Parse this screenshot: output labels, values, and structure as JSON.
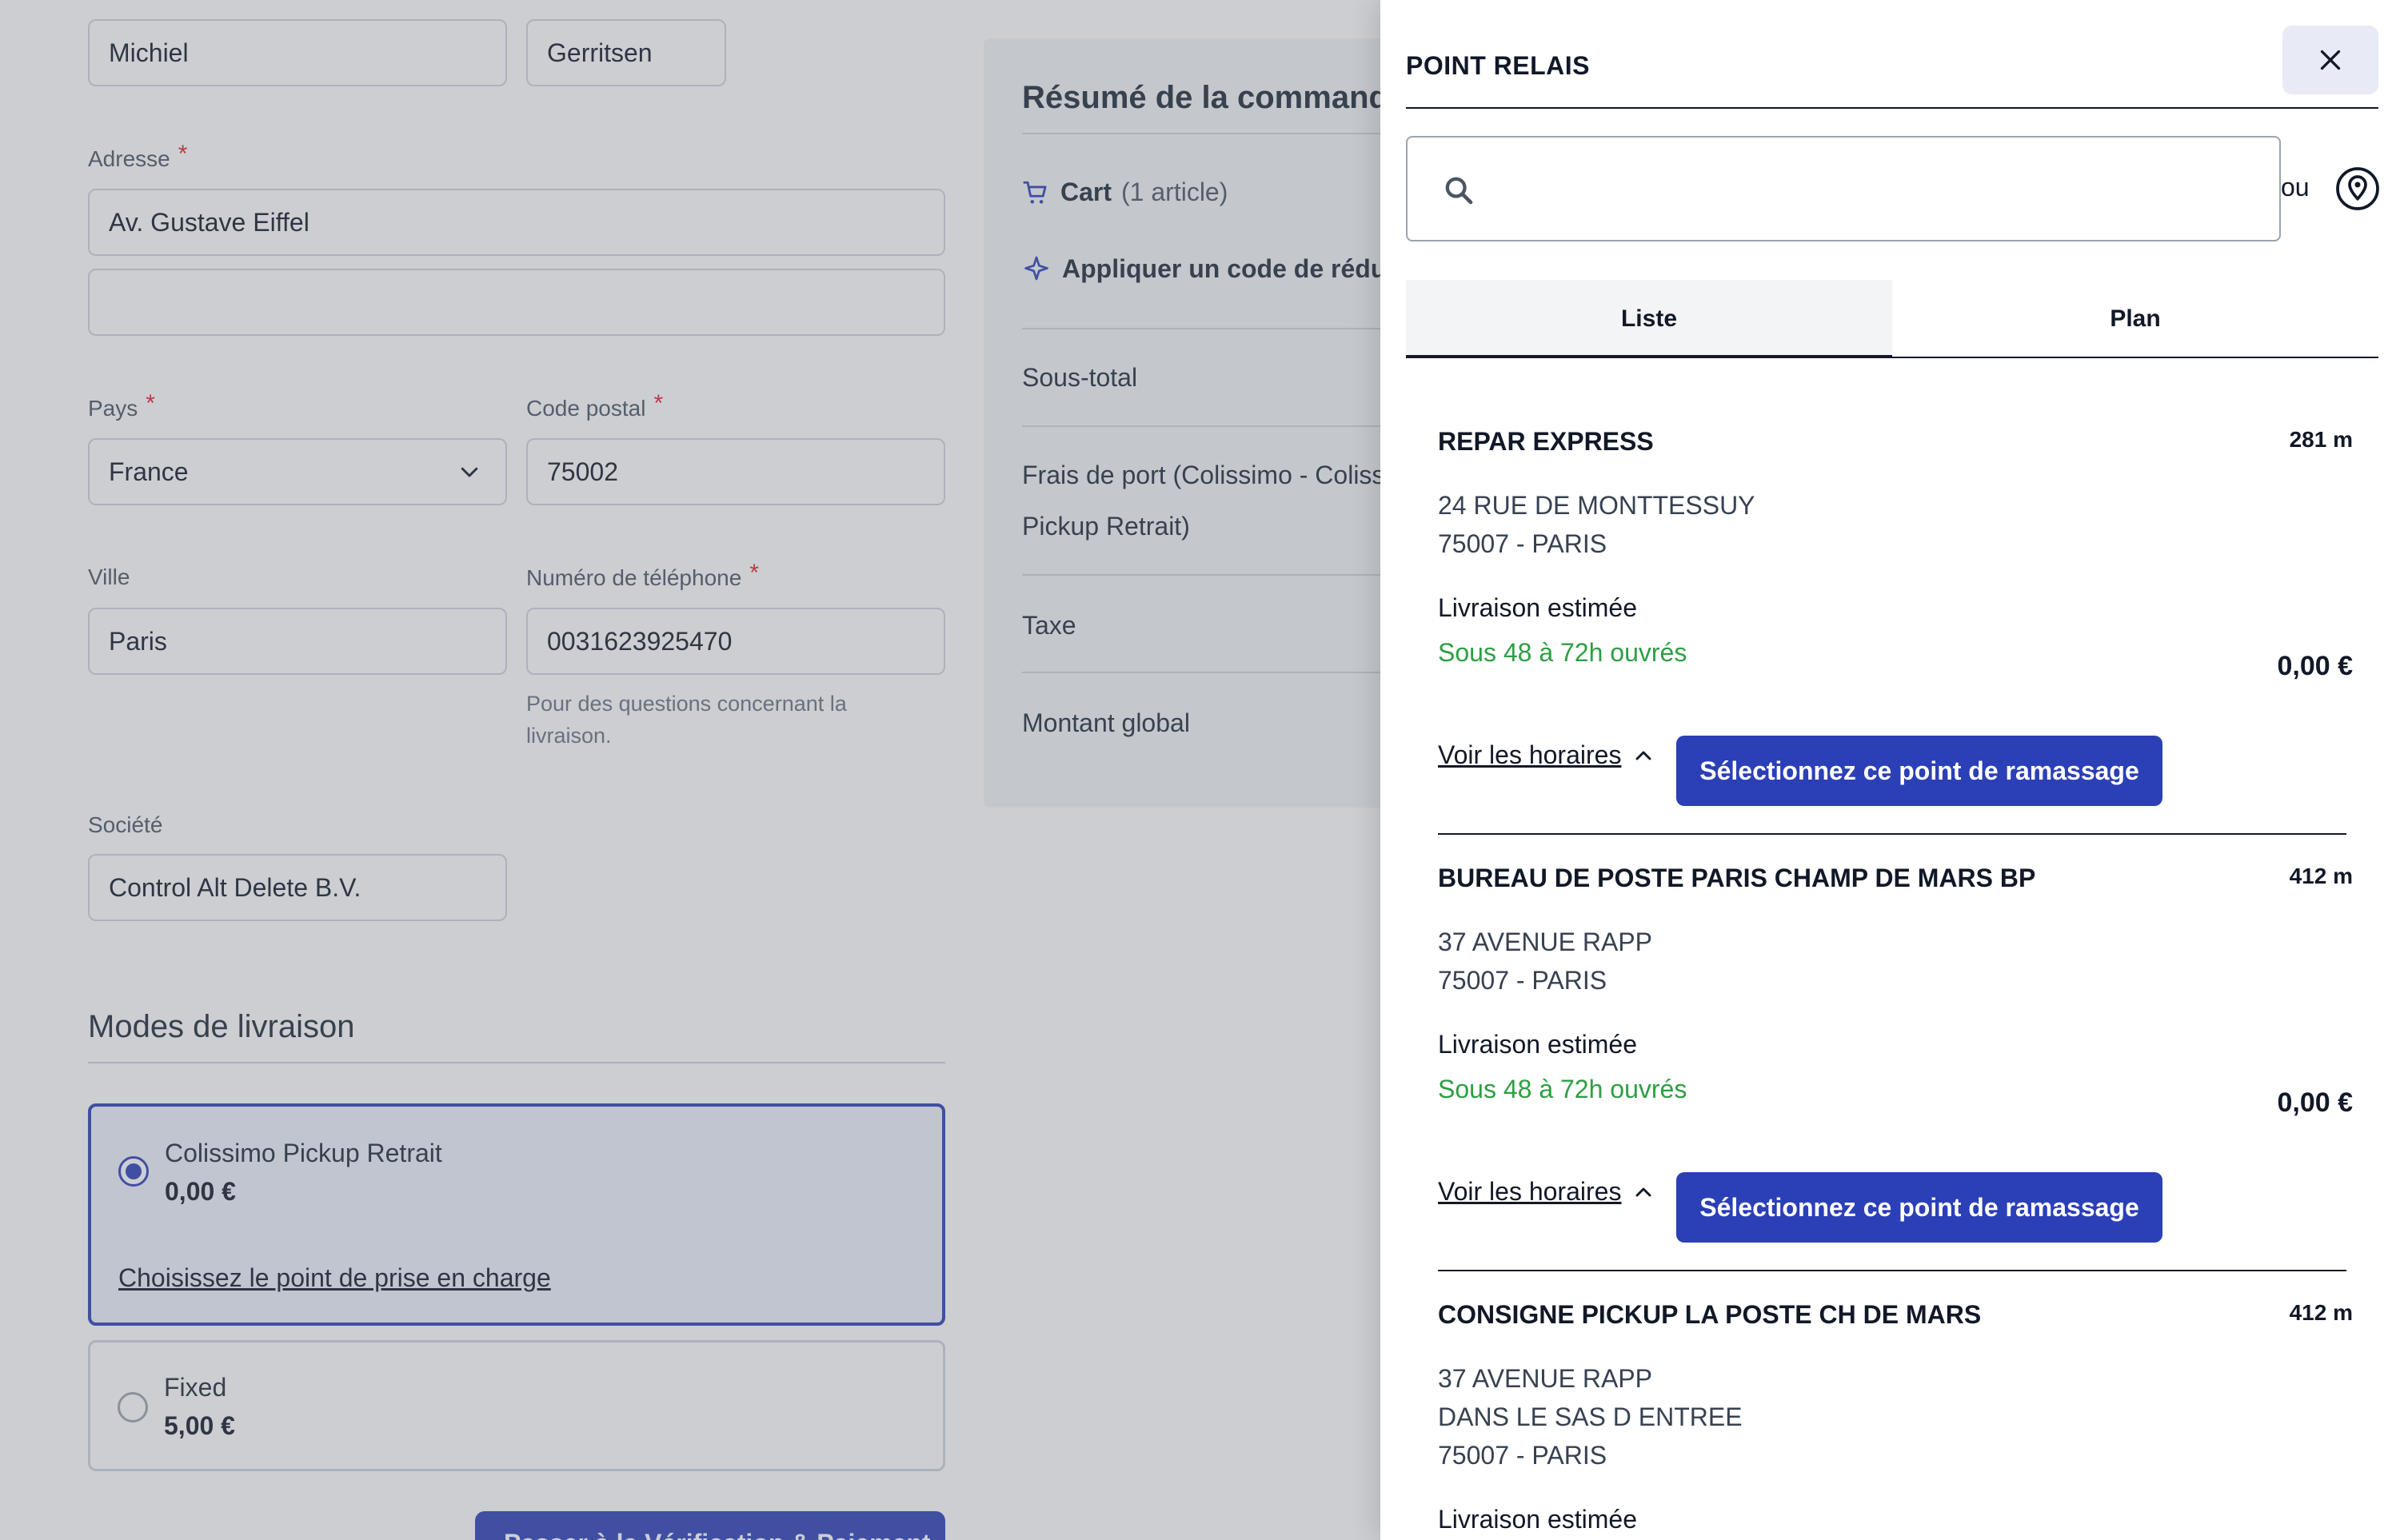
{
  "checkout": {
    "first_name": "Michiel",
    "last_name": "Gerritsen",
    "address_label": "Adresse",
    "address_line1": "Av. Gustave Eiffel",
    "address_line2": "",
    "required_mark": "*",
    "country_label": "Pays",
    "country_value": "France",
    "postal_label": "Code postal",
    "postal_value": "75002",
    "city_label": "Ville",
    "city_value": "Paris",
    "phone_label": "Numéro de téléphone",
    "phone_value": "0031623925470",
    "phone_help": "Pour des questions concernant la livraison.",
    "company_label": "Société",
    "company_value": "Control Alt Delete B.V.",
    "shipping_title": "Modes de livraison",
    "shipping_methods": [
      {
        "name": "Colissimo Pickup Retrait",
        "price": "0,00 €",
        "selected": true,
        "link": "Choisissez le point de prise en charge"
      },
      {
        "name": "Fixed",
        "price": "5,00 €",
        "selected": false
      }
    ],
    "continue_label": "Passer à la Vérification & Paiement"
  },
  "summary": {
    "title": "Résumé de la commande",
    "cart_label": "Cart",
    "cart_count": "(1 article)",
    "discount_label": "Appliquer un code de réduction",
    "subtotal_label": "Sous-total",
    "shipping_label_1": "Frais de port (Colissimo - Colissimo",
    "shipping_label_2": "Pickup Retrait)",
    "tax_label": "Taxe",
    "total_label": "Montant global"
  },
  "drawer": {
    "title": "POINT RELAIS",
    "search_placeholder": "",
    "or_label": "ou",
    "tabs": [
      {
        "label": "Liste",
        "active": true
      },
      {
        "label": "Plan",
        "active": false
      }
    ],
    "relays": [
      {
        "name": "REPAR EXPRESS",
        "distance": "281 m",
        "address": [
          "24 RUE DE MONTTESSUY",
          "75007 - PARIS"
        ],
        "estimate_label": "Livraison estimée",
        "delay": "Sous 48 à 72h ouvrés",
        "price": "0,00 €",
        "hours_label": "Voir les horaires",
        "select_label": "Sélectionnez ce point de ramassage"
      },
      {
        "name": "BUREAU DE POSTE PARIS CHAMP DE MARS BP",
        "distance": "412 m",
        "address": [
          "37 AVENUE RAPP",
          "75007 - PARIS"
        ],
        "estimate_label": "Livraison estimée",
        "delay": "Sous 48 à 72h ouvrés",
        "price": "0,00 €",
        "hours_label": "Voir les horaires",
        "select_label": "Sélectionnez ce point de ramassage"
      },
      {
        "name": "CONSIGNE PICKUP LA POSTE CH DE MARS",
        "distance": "412 m",
        "address": [
          "37 AVENUE RAPP",
          "DANS LE SAS D ENTREE",
          "75007 - PARIS"
        ],
        "estimate_label": "Livraison estimée"
      }
    ]
  },
  "colors": {
    "primary": "#2b3fb7",
    "success": "#2e9e44",
    "required": "#dc2626"
  }
}
